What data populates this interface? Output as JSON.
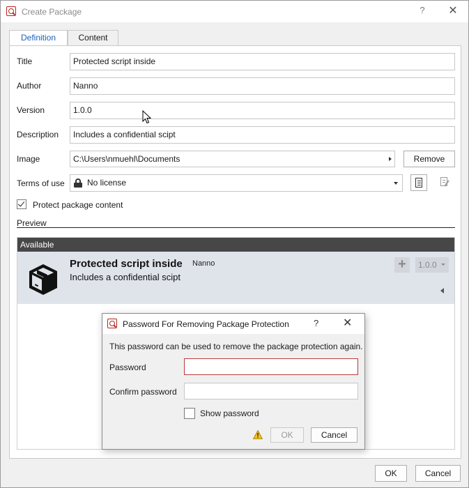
{
  "window": {
    "title": "Create Package",
    "help": "?",
    "close": "✕"
  },
  "tabs": [
    {
      "label": "Definition",
      "active": true
    },
    {
      "label": "Content",
      "active": false
    }
  ],
  "form": {
    "title_label": "Title",
    "title_value": "Protected script inside",
    "author_label": "Author",
    "author_value": "Nanno",
    "version_label": "Version",
    "version_value": "1.0.0",
    "description_label": "Description",
    "description_value": "Includes a confidential scipt",
    "image_label": "Image",
    "image_value": "C:\\Users\\nmuehl\\Documents",
    "remove_label": "Remove",
    "terms_label": "Terms of use",
    "terms_value": "No license",
    "protect_label": "Protect package content",
    "protect_checked": true,
    "preview_label": "Preview"
  },
  "preview": {
    "header": "Available",
    "pkg_title": "Protected script inside",
    "pkg_author": "Nanno",
    "pkg_desc": "Includes a confidential scipt",
    "pkg_version": "1.0.0"
  },
  "footer": {
    "ok_label": "OK",
    "cancel_label": "Cancel"
  },
  "dialog": {
    "title": "Password For Removing Package Protection",
    "help": "?",
    "close": "✕",
    "info": "This password can be used to remove the package protection again.",
    "password_label": "Password",
    "password_value": "",
    "confirm_label": "Confirm password",
    "confirm_value": "",
    "show_label": "Show password",
    "show_checked": false,
    "ok_label": "OK",
    "cancel_label": "Cancel"
  },
  "colors": {
    "accent": "#1f5fb8",
    "preview_header": "#474747",
    "preview_item": "#dfe3ea",
    "error_border": "#b53a3a",
    "icon_red": "#b3261e"
  }
}
